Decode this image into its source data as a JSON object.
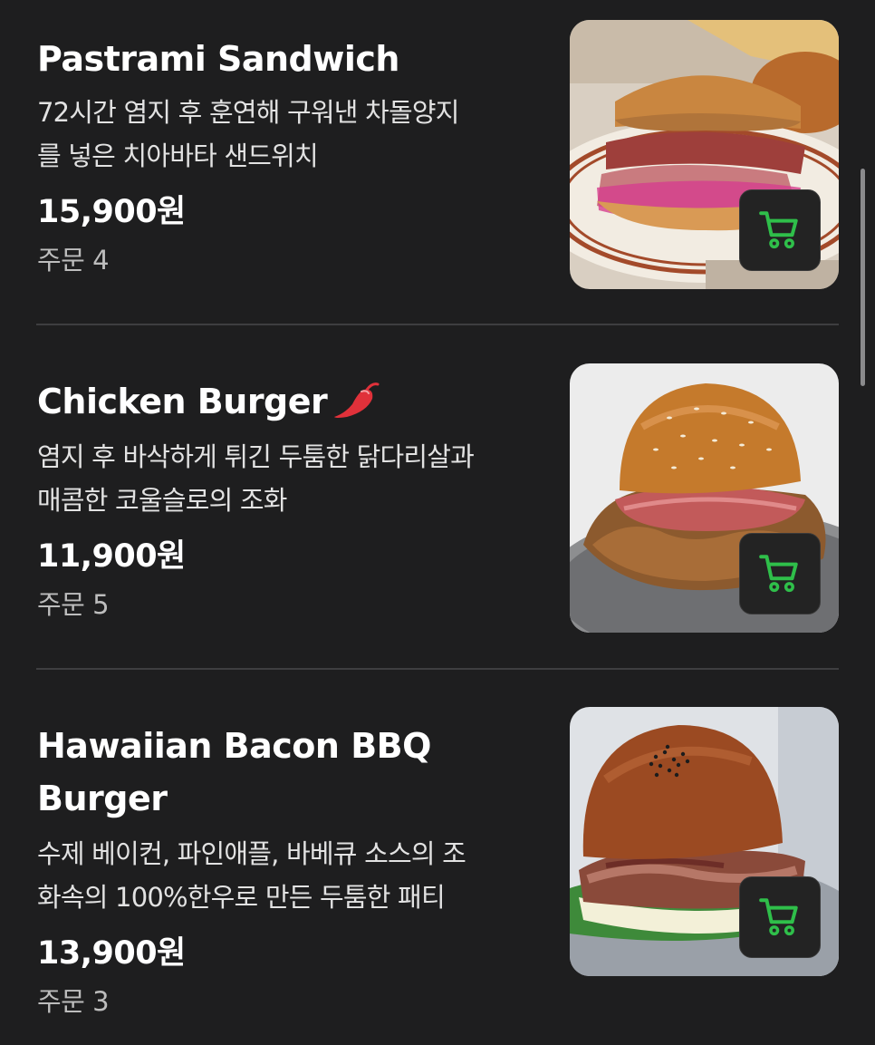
{
  "menu": {
    "items": [
      {
        "name": "Pastrami Sandwich",
        "desc_line1": "72시간 염지 후 훈연해 구워낸 차돌양지",
        "desc_line2": "를 넣은 치아바타 샌드위치",
        "price": "15,900원",
        "orders": "주문 4",
        "spicy": false,
        "image_icon": "pastrami-sandwich-photo",
        "cart_icon": "shopping-cart-icon"
      },
      {
        "name": "Chicken Burger",
        "desc_line1": "염지 후 바삭하게 튀긴 두툼한 닭다리살과",
        "desc_line2": "매콤한 코울슬로의 조화",
        "price": "11,900원",
        "orders": "주문 5",
        "spicy": true,
        "image_icon": "chicken-burger-photo",
        "cart_icon": "shopping-cart-icon"
      },
      {
        "name_line1": "Hawaiian Bacon BBQ",
        "name_line2": "Burger",
        "desc_line1": "수제 베이컨, 파인애플, 바베큐 소스의 조",
        "desc_line2": "화속의 100%한우로 만든 두툼한 패티",
        "price": "13,900원",
        "orders": "주문 3",
        "spicy": false,
        "image_icon": "hawaiian-bacon-bbq-burger-photo",
        "cart_icon": "shopping-cart-icon"
      }
    ]
  },
  "colors": {
    "background": "#1e1e1f",
    "cart_accent": "#2fbf4a",
    "spicy_icon": "#e0313a"
  }
}
